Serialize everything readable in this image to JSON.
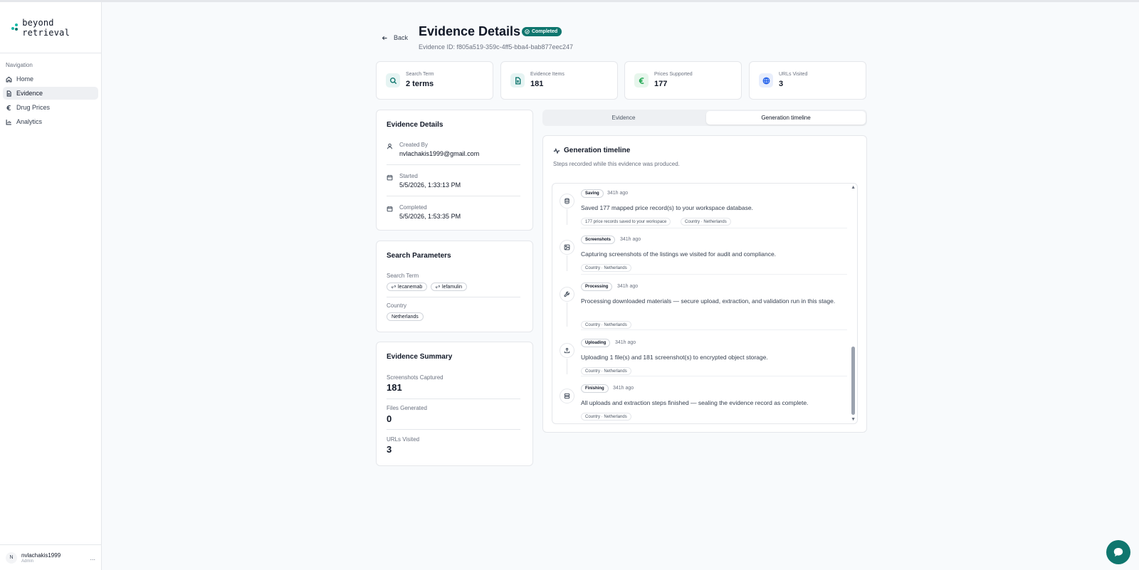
{
  "brand": {
    "name": "beyond retrieval",
    "accent": "#14b8a6"
  },
  "sidebar": {
    "heading": "Navigation",
    "items": [
      {
        "label": "Home",
        "icon": "home-icon",
        "active": false
      },
      {
        "label": "Evidence",
        "icon": "document-icon",
        "active": true
      },
      {
        "label": "Drug Prices",
        "icon": "euro-icon",
        "active": false
      },
      {
        "label": "Analytics",
        "icon": "bar-chart-icon",
        "active": false
      }
    ],
    "user": {
      "initial": "N",
      "name": "nvlachakis1999",
      "role": "Admin",
      "more": "..."
    }
  },
  "header": {
    "back_label": "Back",
    "title": "Evidence Details",
    "status": "Completed",
    "status_color": "#0f766e",
    "evidence_id": "Evidence ID: f805a519-359c-4ff5-bba4-bab877eec247"
  },
  "stats": [
    {
      "label": "Search Term",
      "value": "2 terms",
      "icon": "search-icon",
      "color": "#0f766e",
      "bg": "#e6f4f3"
    },
    {
      "label": "Evidence Items",
      "value": "181",
      "icon": "file-icon",
      "color": "#0f766e",
      "bg": "#e6f4f3"
    },
    {
      "label": "Prices Supported",
      "value": "177",
      "icon": "euro-icon",
      "color": "#16a34a",
      "bg": "#e7f6ec"
    },
    {
      "label": "URLs Visited",
      "value": "3",
      "icon": "globe-icon",
      "color": "#2563eb",
      "bg": "#e8eefc"
    }
  ],
  "details": {
    "title": "Evidence Details",
    "created_by_label": "Created By",
    "created_by": "nvlachakis1999@gmail.com",
    "started_label": "Started",
    "started": "5/5/2026, 1:33:13 PM",
    "completed_label": "Completed",
    "completed": "5/5/2026, 1:53:35 PM"
  },
  "params": {
    "title": "Search Parameters",
    "search_term_label": "Search Term",
    "terms": [
      "lecanemab",
      "lefamulin"
    ],
    "country_label": "Country",
    "country": "Netherlands"
  },
  "summary": {
    "title": "Evidence Summary",
    "screenshots_label": "Screenshots Captured",
    "screenshots": "181",
    "files_label": "Files Generated",
    "files": "0",
    "urls_label": "URLs Visited",
    "urls": "3"
  },
  "tabs": [
    {
      "label": "Evidence",
      "active": false
    },
    {
      "label": "Generation timeline",
      "active": true
    }
  ],
  "timeline": {
    "title": "Generation timeline",
    "subtitle": "Steps recorded while this evidence was produced.",
    "entries": [
      {
        "stage": "Saving",
        "time": "341h ago",
        "icon": "database-icon",
        "message": "Saved 177 mapped price record(s) to your workspace database.",
        "chips": [
          "177 price records saved to your workspace",
          "Country · Netherlands"
        ]
      },
      {
        "stage": "Screenshots",
        "time": "341h ago",
        "icon": "image-icon",
        "message": "Capturing screenshots of the listings we visited for audit and compliance.",
        "chips": [
          "Country · Netherlands"
        ]
      },
      {
        "stage": "Processing",
        "time": "341h ago",
        "icon": "wrench-icon",
        "message": "Processing downloaded materials — secure upload, extraction, and validation run in this stage.",
        "chips": [
          "Country · Netherlands"
        ]
      },
      {
        "stage": "Uploading",
        "time": "341h ago",
        "icon": "upload-icon",
        "message": "Uploading 1 file(s) and 181 screenshot(s) to encrypted object storage.",
        "chips": [
          "Country · Netherlands"
        ]
      },
      {
        "stage": "Finishing",
        "time": "341h ago",
        "icon": "server-icon",
        "message": "All uploads and extraction steps finished — sealing the evidence record as complete.",
        "chips": [
          "Country · Netherlands"
        ]
      }
    ]
  },
  "chat": {
    "icon": "chat-bubble-icon"
  }
}
